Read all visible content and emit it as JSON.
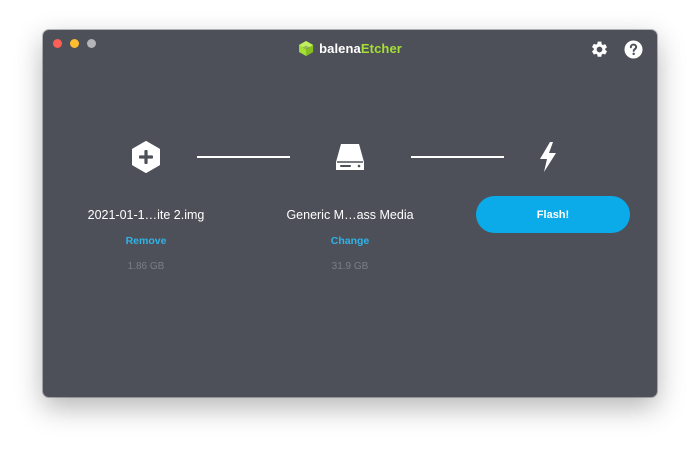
{
  "app": {
    "name_part1": "balena",
    "name_part2": "Etcher"
  },
  "top_icons": [
    "gear-icon",
    "help-icon"
  ],
  "steps": {
    "image": {
      "icon": "plus-hexagon-icon",
      "filename": "2021-01-1…ite 2.img",
      "action_label": "Remove",
      "size": "1.86 GB"
    },
    "target": {
      "icon": "drive-icon",
      "name": "Generic M…ass Media",
      "action_label": "Change",
      "size": "31.9 GB"
    },
    "flash": {
      "icon": "lightning-icon",
      "button_label": "Flash!"
    }
  },
  "colors": {
    "window_bg": "#4d5058",
    "accent": "#0aabe8",
    "link": "#2eb4ea",
    "brand_green": "#a5de37"
  }
}
